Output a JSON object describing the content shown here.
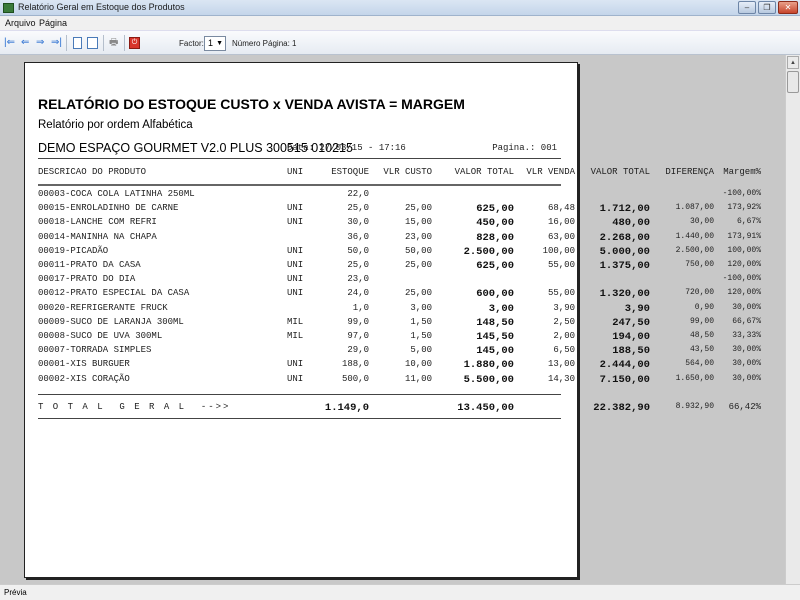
{
  "window": {
    "title": "Relatório Geral em Estoque dos Produtos"
  },
  "menu": [
    "Arquivo",
    "Página"
  ],
  "toolbar": {
    "factor_label": "Factor:",
    "factor_value": "1",
    "page_label": "Número Página: 1"
  },
  "status": "Prévia",
  "report": {
    "title": "RELATÓRIO DO ESTOQUE CUSTO x VENDA AVISTA = MARGEM",
    "subtitle": "Relatório por ordem Alfabética",
    "company": "DEMO ESPAÇO GOURMET V2.0 PLUS 300515 010215",
    "date": "Data: 27/03/15 - 17:16",
    "page": "Pagina.: 001",
    "headers": [
      "DESCRICAO DO PRODUTO",
      "UNI",
      "ESTOQUE",
      "VLR CUSTO",
      "VALOR TOTAL",
      "VLR VENDA",
      "VALOR TOTAL",
      "DIFERENÇA",
      "Margem%"
    ],
    "rows": [
      [
        "00003-COCA COLA LATINHA 250ML",
        "",
        "22,0",
        "",
        "",
        "",
        "",
        "",
        "-100,00%"
      ],
      [
        "00015-ENROLADINHO DE CARNE",
        "UNI",
        "25,0",
        "25,00",
        "625,00",
        "68,48",
        "1.712,00",
        "1.087,00",
        "173,92%"
      ],
      [
        "00018-LANCHE COM REFRI",
        "UNI",
        "30,0",
        "15,00",
        "450,00",
        "16,00",
        "480,00",
        "30,00",
        "6,67%"
      ],
      [
        "00014-MANINHA NA CHAPA",
        "",
        "36,0",
        "23,00",
        "828,00",
        "63,00",
        "2.268,00",
        "1.440,00",
        "173,91%"
      ],
      [
        "00019-PICADÃO",
        "UNI",
        "50,0",
        "50,00",
        "2.500,00",
        "100,00",
        "5.000,00",
        "2.500,00",
        "100,00%"
      ],
      [
        "00011-PRATO DA CASA",
        "UNI",
        "25,0",
        "25,00",
        "625,00",
        "55,00",
        "1.375,00",
        "750,00",
        "120,00%"
      ],
      [
        "00017-PRATO DO DIA",
        "UNI",
        "23,0",
        "",
        "",
        "",
        "",
        "",
        "-100,00%"
      ],
      [
        "00012-PRATO ESPECIAL DA CASA",
        "UNI",
        "24,0",
        "25,00",
        "600,00",
        "55,00",
        "1.320,00",
        "720,00",
        "120,00%"
      ],
      [
        "00020-REFRIGERANTE FRUCK",
        "",
        "1,0",
        "3,00",
        "3,00",
        "3,90",
        "3,90",
        "0,90",
        "30,00%"
      ],
      [
        "00009-SUCO DE LARANJA 300ML",
        "MIL",
        "99,0",
        "1,50",
        "148,50",
        "2,50",
        "247,50",
        "99,00",
        "66,67%"
      ],
      [
        "00008-SUCO DE UVA 300ML",
        "MIL",
        "97,0",
        "1,50",
        "145,50",
        "2,00",
        "194,00",
        "48,50",
        "33,33%"
      ],
      [
        "00007-TORRADA SIMPLES",
        "",
        "29,0",
        "5,00",
        "145,00",
        "6,50",
        "188,50",
        "43,50",
        "30,00%"
      ],
      [
        "00001-XIS BURGUER",
        "UNI",
        "188,0",
        "10,00",
        "1.880,00",
        "13,00",
        "2.444,00",
        "564,00",
        "30,00%"
      ],
      [
        "00002-XIS CORAÇÃO",
        "UNI",
        "500,0",
        "11,00",
        "5.500,00",
        "14,30",
        "7.150,00",
        "1.650,00",
        "30,00%"
      ]
    ],
    "total": {
      "label": "T O T A L  G E R A L  -->>",
      "estoque": "1.149,0",
      "custo_total": "13.450,00",
      "venda_total": "22.382,90",
      "diferenca": "8.932,90",
      "margem": "66,42%"
    }
  }
}
